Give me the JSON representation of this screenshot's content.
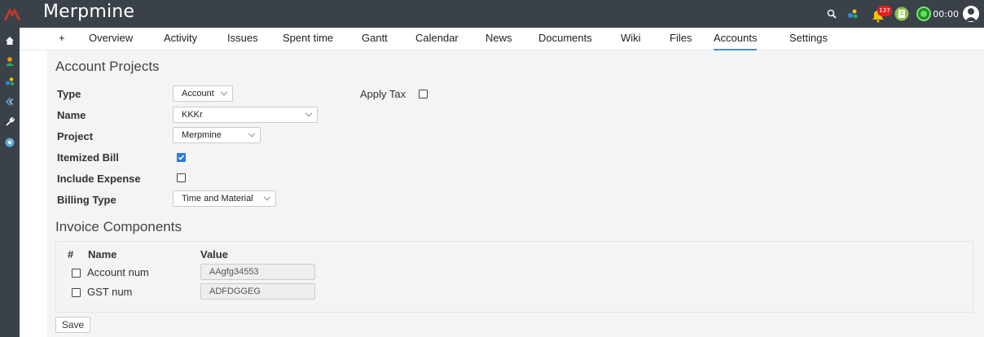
{
  "app": {
    "title": "Merpmine"
  },
  "topbar": {
    "notification_count": "137",
    "timer": "00:00",
    "icons": [
      "search-icon",
      "modules-icon",
      "bell-icon",
      "clipboard-icon",
      "timer-icon",
      "user-avatar-icon"
    ]
  },
  "sidebar": {
    "icons": [
      "home-icon",
      "user-icon",
      "modules-icon",
      "arrows-icon",
      "wrench-icon",
      "help-icon"
    ]
  },
  "tabs": [
    {
      "label": "+"
    },
    {
      "label": "Overview"
    },
    {
      "label": "Activity"
    },
    {
      "label": "Issues"
    },
    {
      "label": "Spent time"
    },
    {
      "label": "Gantt"
    },
    {
      "label": "Calendar"
    },
    {
      "label": "News"
    },
    {
      "label": "Documents"
    },
    {
      "label": "Wiki"
    },
    {
      "label": "Files"
    },
    {
      "label": "Accounts"
    },
    {
      "label": "Settings"
    }
  ],
  "active_tab": "Accounts",
  "form": {
    "heading": "Account Projects",
    "type_label": "Type",
    "type_value": "Account",
    "apply_tax_label": "Apply Tax",
    "apply_tax_checked": false,
    "name_label": "Name",
    "name_value": "KKKr",
    "project_label": "Project",
    "project_value": "Merpmine",
    "itemized_bill_label": "Itemized Bill",
    "itemized_bill_checked": true,
    "include_expense_label": "Include Expense",
    "include_expense_checked": false,
    "billing_type_label": "Billing Type",
    "billing_type_value": "Time and Material"
  },
  "invoice": {
    "heading": "Invoice Components",
    "columns": [
      "#",
      "Name",
      "Value"
    ],
    "rows": [
      {
        "name": "Account num",
        "value": "AAgfg34553",
        "checked": false
      },
      {
        "name": "GST num",
        "value": "ADFDGGEG",
        "checked": false
      }
    ]
  },
  "actions": {
    "save_label": "Save"
  },
  "colors": {
    "topbar": "#3a4149",
    "content_bg": "#f3f4f5",
    "accent": "#4a90c4",
    "checkbox": "#2a7ad6",
    "badge": "#e02020"
  }
}
